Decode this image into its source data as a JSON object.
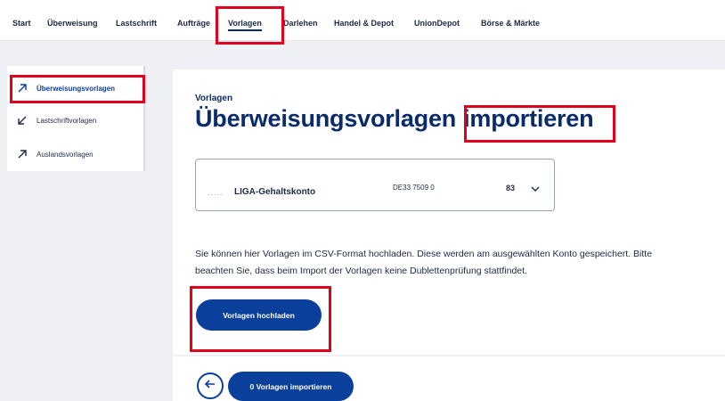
{
  "nav": {
    "items": [
      "Start",
      "Überweisung",
      "Lastschrift",
      "Aufträge",
      "Vorlagen",
      "Darlehen",
      "Handel & Depot",
      "UnionDepot",
      "Börse & Märkte"
    ],
    "active": "Vorlagen"
  },
  "sidebar": {
    "items": [
      {
        "label": "Überweisungsvorlagen",
        "icon": "arrow-up-right-icon",
        "active": true
      },
      {
        "label": "Lastschriftvorlagen",
        "icon": "arrow-down-left-icon",
        "active": false
      },
      {
        "label": "Auslandsvorlagen",
        "icon": "arrow-up-right-icon",
        "active": false
      }
    ]
  },
  "page": {
    "eyebrow": "Vorlagen",
    "title_part1": "Überweisungsvorlagen",
    "title_part2": "importieren"
  },
  "account": {
    "name": "LIGA-Gehaltskonto",
    "iban": "DE33 7509 0",
    "number": "83"
  },
  "info": {
    "line1": "Sie können hier Vorlagen im CSV-Format hochladen. Diese werden am ausgewählten Konto gespeichert. Bitte",
    "line2": "beachten Sie, dass beim Import der Vorlagen keine Dublettenprüfung stattfindet."
  },
  "buttons": {
    "upload": "Vorlagen hochladen",
    "import": "0 Vorlagen importieren"
  },
  "colors": {
    "primary": "#0a3f9c",
    "highlight": "#e3001b",
    "background": "#eef0f5"
  }
}
